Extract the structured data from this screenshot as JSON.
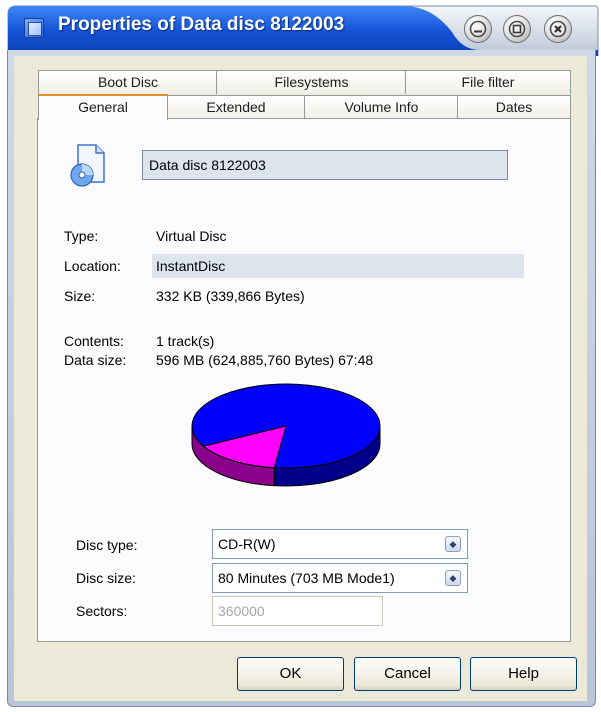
{
  "window": {
    "title": "Properties of Data disc 8122003",
    "title_icon": "app-icon",
    "controls": [
      "minimize-icon",
      "maximize-icon",
      "close-icon"
    ]
  },
  "tabs": {
    "row1": [
      "Boot Disc",
      "Filesystems",
      "File filter"
    ],
    "row2": [
      "General",
      "Extended",
      "Volume Info",
      "Dates"
    ],
    "active": "General"
  },
  "general": {
    "disc_name": "Data disc 8122003",
    "disc_icon": "disc-file-icon",
    "type_label": "Type:",
    "type_value": "Virtual Disc",
    "location_label": "Location:",
    "location_value": "InstantDisc",
    "size_label": "Size:",
    "size_value": "332 KB (339,866 Bytes)",
    "contents_label": "Contents:",
    "contents_value": "1 track(s)",
    "datasize_label": "Data size:",
    "datasize_value": "596 MB (624,885,760 Bytes) 67:48"
  },
  "usage_pie": {
    "used_fraction": 0.85,
    "colors": {
      "used": "#0000ff",
      "free": "#ff00ff",
      "used_side": "#00008b",
      "free_side": "#8b008b"
    }
  },
  "disc_settings": {
    "disc_type_label": "Disc type:",
    "disc_type_value": "CD-R(W)",
    "disc_size_label": "Disc size:",
    "disc_size_value": "80 Minutes (703 MB Mode1)",
    "sectors_label": "Sectors:",
    "sectors_value": "360000"
  },
  "buttons": {
    "ok": "OK",
    "cancel": "Cancel",
    "help": "Help"
  },
  "colors": {
    "titlebar": "#0a4fd6",
    "tab_active_accent": "#e68b2c",
    "highlight": "#dde4ee"
  }
}
